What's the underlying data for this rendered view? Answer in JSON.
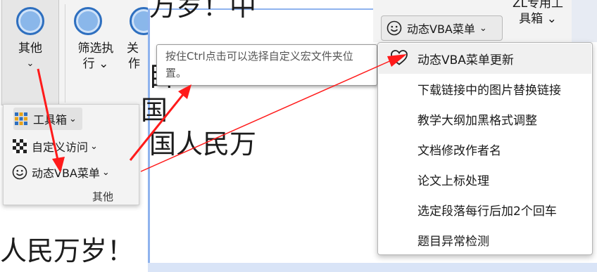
{
  "ribbon": {
    "groups": [
      {
        "label_line1": "其他",
        "chevron": "⌄"
      },
      {
        "label_line1": "筛选执",
        "label_line2": "行 ⌄"
      },
      {
        "label_line1": "关",
        "label_line2": "作"
      }
    ]
  },
  "document": {
    "fragments": {
      "top_left": "万岁！中",
      "mid1": "目",
      "mid2": "国",
      "main_line": "国人民万",
      "bottom_left": "人民万岁！"
    }
  },
  "popup_panel": {
    "items": [
      {
        "label": "工具箱",
        "icon": "toolbox-icon",
        "chevron": "⌄"
      },
      {
        "label": "自定义访问",
        "icon": "checkerboard-icon",
        "chevron": "⌄"
      },
      {
        "label": "动态VBA菜单",
        "icon": "smiley-icon",
        "chevron": "⌄"
      }
    ],
    "group_caption": "其他"
  },
  "tooltip": {
    "text": "按住Ctrl点击可以选择自定义宏文件夹位置。"
  },
  "right_ribbon": {
    "vba_button_label": "动态VBA菜单",
    "vba_button_chevron": "⌄",
    "zl_line1": "ZL专用工",
    "zl_line2": "具箱 ⌄"
  },
  "dropdown_menu": {
    "items": [
      {
        "label": "动态VBA菜单更新",
        "icon": "heart-icon"
      },
      {
        "label": "下载链接中的图片替换链接"
      },
      {
        "label": "教学大纲加黑格式调整"
      },
      {
        "label": "文档修改作者名"
      },
      {
        "label": "论文上标处理"
      },
      {
        "label": "选定段落每行后加2个回车"
      },
      {
        "label": "题目异常检测"
      }
    ]
  },
  "colors": {
    "ribbon_bg": "#f3f3f3",
    "ribbon_icon_blue": "#2e6fbf",
    "annotation_red": "#ff1a1a",
    "window_border": "#8fb3ee"
  }
}
